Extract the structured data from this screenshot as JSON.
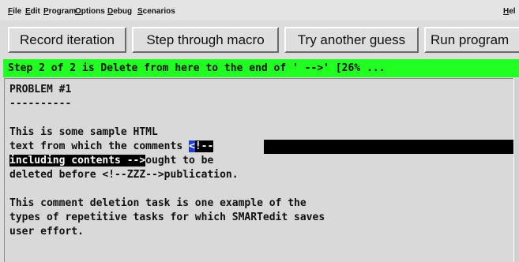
{
  "menu": [
    {
      "mnemonic": "F",
      "rest": "ile"
    },
    {
      "mnemonic": "E",
      "rest": "dit"
    },
    {
      "mnemonic": "P",
      "rest": "rogram"
    },
    {
      "mnemonic": "O",
      "rest": "ptions"
    },
    {
      "mnemonic": "D",
      "rest": "ebug"
    },
    {
      "mnemonic": "S",
      "rest": "cenarios"
    },
    {
      "mnemonic": "H",
      "rest": "el"
    }
  ],
  "toolbar": {
    "record_label": "Record iteration",
    "step_label": "Step through macro",
    "guess_label": "Try another guess",
    "run_label": "Run program"
  },
  "status_text": "Step 2 of 2 is Delete from here to the end of ' -->' [26% ...",
  "editor": {
    "line1": "PROBLEM #1",
    "line2": "----------",
    "line4": "This is some sample HTML",
    "line5_before": "text from which the comments ",
    "line5_cursor": "<",
    "line5_selected": "!--",
    "line6_selected": "including contents -->",
    "line6_after": "ought to be",
    "line7": "deleted before <!--ZZZ-->publication.",
    "line9": "This comment deletion task is one example of the",
    "line10": "types of repetitive tasks for which SMARTedit saves",
    "line11": "user effort."
  },
  "colors": {
    "status_bar": "#22ff22",
    "selection": "#000000",
    "cursor": "#1f3fd0"
  }
}
